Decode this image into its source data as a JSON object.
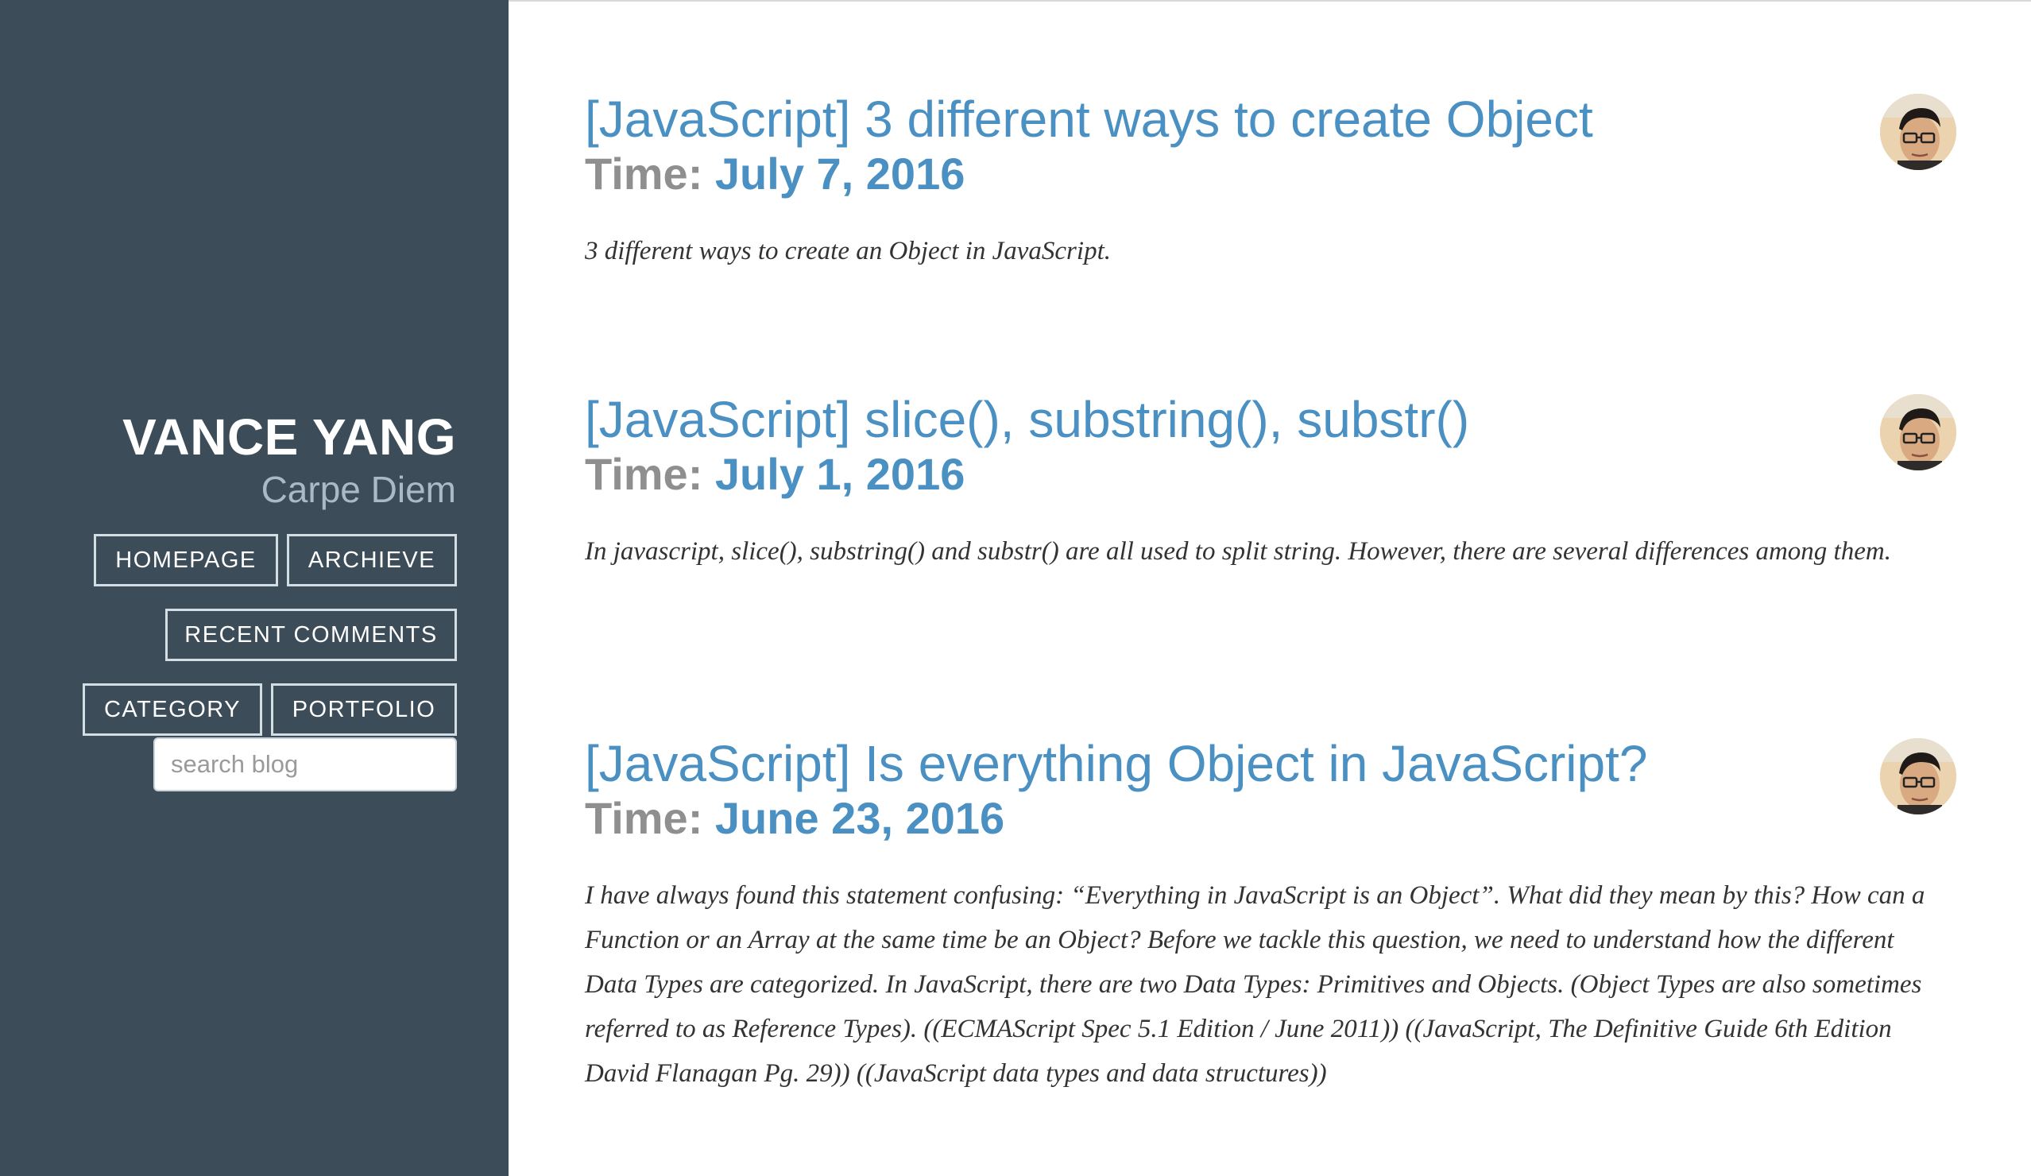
{
  "sidebar": {
    "title": "VANCE YANG",
    "subtitle": "Carpe Diem",
    "nav": {
      "homepage": "HOMEPAGE",
      "archieve": "ARCHIEVE",
      "recent_comments": "RECENT COMMENTS",
      "category": "CATEGORY",
      "portfolio": "PORTFOLIO"
    },
    "search": {
      "placeholder": "search blog",
      "value": ""
    },
    "colors": {
      "background": "#3c4d59",
      "text": "#ffffff",
      "subtitle": "#a9bac6"
    }
  },
  "posts": [
    {
      "title": "[JavaScript] 3 different ways to create Object",
      "time_label": "Time:",
      "date": "July 7, 2016",
      "excerpt": "3 different ways to create an Object in JavaScript.",
      "avatar_icon": "author-avatar"
    },
    {
      "title": "[JavaScript] slice(), substring(), substr()",
      "time_label": "Time:",
      "date": "July 1, 2016",
      "excerpt": "In javascript, slice(), substring() and substr() are all used to split string. However, there are several differences among them.",
      "avatar_icon": "author-avatar"
    },
    {
      "title": "[JavaScript] Is everything Object in JavaScript?",
      "time_label": "Time:",
      "date": "June 23, 2016",
      "excerpt": "I have always found this statement confusing: “Everything in JavaScript is an Object”. What did they mean by this? How can a Function or an Array at the same time be an Object? Before we tackle this question, we need to understand how the different Data Types are categorized. In JavaScript, there are two Data Types: Primitives and Objects. (Object Types are also sometimes referred to as Reference Types). ((ECMAScript Spec 5.1 Edition / June 2011)) ((JavaScript, The Definitive Guide 6th Edition David Flanagan Pg. 29)) ((JavaScript data types and data structures))",
      "avatar_icon": "author-avatar"
    }
  ],
  "colors": {
    "link": "#4a90c2",
    "time_label": "#8f8f8f",
    "excerpt": "#333333"
  }
}
